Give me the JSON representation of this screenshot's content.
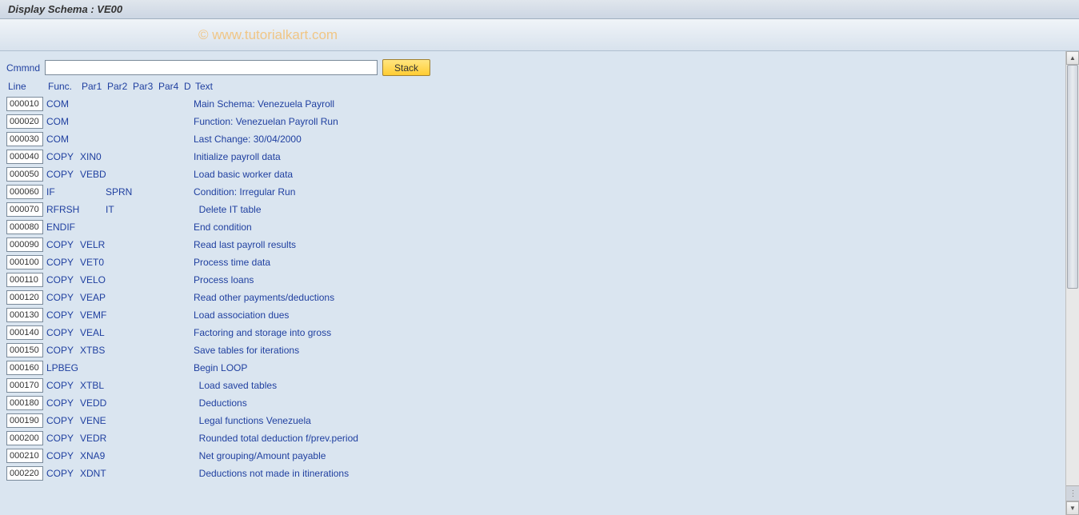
{
  "title": "Display Schema : VE00",
  "watermark": "© www.tutorialkart.com",
  "command": {
    "label": "Cmmnd",
    "value": "",
    "stack_label": "Stack"
  },
  "headers": {
    "line": "Line",
    "func": "Func.",
    "par1": "Par1",
    "par2": "Par2",
    "par3": "Par3",
    "par4": "Par4",
    "d": "D",
    "text": "Text"
  },
  "rows": [
    {
      "line": "000010",
      "func": "COM",
      "par1": "",
      "par2": "",
      "par3": "",
      "par4": "",
      "d": "",
      "text": "Main Schema: Venezuela Payroll"
    },
    {
      "line": "000020",
      "func": "COM",
      "par1": "",
      "par2": "",
      "par3": "",
      "par4": "",
      "d": "",
      "text": "Function: Venezuelan Payroll Run"
    },
    {
      "line": "000030",
      "func": "COM",
      "par1": "",
      "par2": "",
      "par3": "",
      "par4": "",
      "d": "",
      "text": "Last Change: 30/04/2000"
    },
    {
      "line": "000040",
      "func": "COPY",
      "par1": "XIN0",
      "par2": "",
      "par3": "",
      "par4": "",
      "d": "",
      "text": "Initialize payroll data"
    },
    {
      "line": "000050",
      "func": "COPY",
      "par1": "VEBD",
      "par2": "",
      "par3": "",
      "par4": "",
      "d": "",
      "text": "Load basic worker data"
    },
    {
      "line": "000060",
      "func": "IF",
      "par1": "",
      "par2": "SPRN",
      "par3": "",
      "par4": "",
      "d": "",
      "text": "Condition: Irregular Run"
    },
    {
      "line": "000070",
      "func": "RFRSH",
      "par1": "",
      "par2": "IT",
      "par3": "",
      "par4": "",
      "d": "",
      "text": "  Delete IT table"
    },
    {
      "line": "000080",
      "func": "ENDIF",
      "par1": "",
      "par2": "",
      "par3": "",
      "par4": "",
      "d": "",
      "text": "End condition"
    },
    {
      "line": "000090",
      "func": "COPY",
      "par1": "VELR",
      "par2": "",
      "par3": "",
      "par4": "",
      "d": "",
      "text": "Read last payroll results"
    },
    {
      "line": "000100",
      "func": "COPY",
      "par1": "VET0",
      "par2": "",
      "par3": "",
      "par4": "",
      "d": "",
      "text": "Process time data"
    },
    {
      "line": "000110",
      "func": "COPY",
      "par1": "VELO",
      "par2": "",
      "par3": "",
      "par4": "",
      "d": "",
      "text": "Process loans"
    },
    {
      "line": "000120",
      "func": "COPY",
      "par1": "VEAP",
      "par2": "",
      "par3": "",
      "par4": "",
      "d": "",
      "text": "Read other payments/deductions"
    },
    {
      "line": "000130",
      "func": "COPY",
      "par1": "VEMF",
      "par2": "",
      "par3": "",
      "par4": "",
      "d": "",
      "text": "Load association dues"
    },
    {
      "line": "000140",
      "func": "COPY",
      "par1": "VEAL",
      "par2": "",
      "par3": "",
      "par4": "",
      "d": "",
      "text": "Factoring and storage into gross"
    },
    {
      "line": "000150",
      "func": "COPY",
      "par1": "XTBS",
      "par2": "",
      "par3": "",
      "par4": "",
      "d": "",
      "text": "Save tables for iterations"
    },
    {
      "line": "000160",
      "func": "LPBEG",
      "par1": "",
      "par2": "",
      "par3": "",
      "par4": "",
      "d": "",
      "text": "Begin LOOP"
    },
    {
      "line": "000170",
      "func": "COPY",
      "par1": "XTBL",
      "par2": "",
      "par3": "",
      "par4": "",
      "d": "",
      "text": "  Load saved tables"
    },
    {
      "line": "000180",
      "func": "COPY",
      "par1": "VEDD",
      "par2": "",
      "par3": "",
      "par4": "",
      "d": "",
      "text": "  Deductions"
    },
    {
      "line": "000190",
      "func": "COPY",
      "par1": "VENE",
      "par2": "",
      "par3": "",
      "par4": "",
      "d": "",
      "text": "  Legal functions Venezuela"
    },
    {
      "line": "000200",
      "func": "COPY",
      "par1": "VEDR",
      "par2": "",
      "par3": "",
      "par4": "",
      "d": "",
      "text": "  Rounded total deduction f/prev.period"
    },
    {
      "line": "000210",
      "func": "COPY",
      "par1": "XNA9",
      "par2": "",
      "par3": "",
      "par4": "",
      "d": "",
      "text": "  Net grouping/Amount payable"
    },
    {
      "line": "000220",
      "func": "COPY",
      "par1": "XDNT",
      "par2": "",
      "par3": "",
      "par4": "",
      "d": "",
      "text": "  Deductions not made in itinerations"
    }
  ]
}
